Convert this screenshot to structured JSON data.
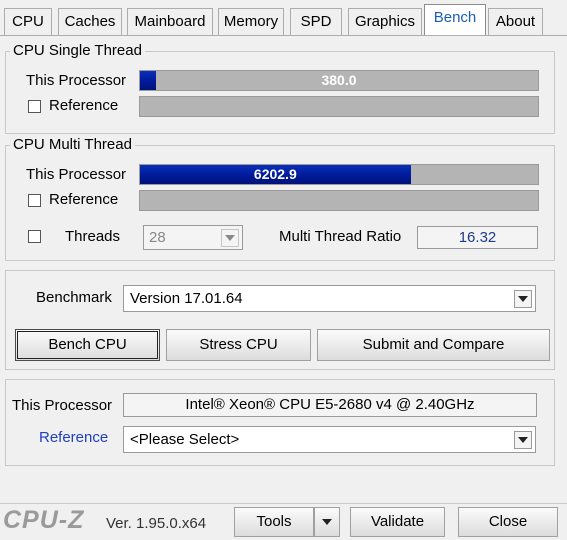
{
  "tabs": [
    "CPU",
    "Caches",
    "Mainboard",
    "Memory",
    "SPD",
    "Graphics",
    "Bench",
    "About"
  ],
  "active_tab": "Bench",
  "single_thread": {
    "title": "CPU Single Thread",
    "this_label": "This Processor",
    "this_value": "380.0",
    "this_fraction": 0.04,
    "reference_label": "Reference"
  },
  "multi_thread": {
    "title": "CPU Multi Thread",
    "this_label": "This Processor",
    "this_value": "6202.9",
    "this_fraction": 0.68,
    "reference_label": "Reference",
    "threads_label": "Threads",
    "threads_value": "28",
    "ratio_label": "Multi Thread Ratio",
    "ratio_value": "16.32"
  },
  "benchmark": {
    "label": "Benchmark",
    "version": "Version 17.01.64",
    "bench_cpu": "Bench CPU",
    "stress_cpu": "Stress CPU",
    "submit_compare": "Submit and Compare"
  },
  "processor": {
    "this_label": "This Processor",
    "this_value": "Intel® Xeon® CPU E5-2680 v4 @ 2.40GHz",
    "reference_label": "Reference",
    "reference_value": "<Please Select>"
  },
  "footer": {
    "logo": "CPU-Z",
    "version": "Ver. 1.95.0.x64",
    "tools": "Tools",
    "validate": "Validate",
    "close": "Close"
  },
  "colors": {
    "bar_fill": "#001a99",
    "bar_bg": "#b4b4b4",
    "active_tab_text": "#1a5fb4",
    "reference_link": "#1f3fbf"
  }
}
